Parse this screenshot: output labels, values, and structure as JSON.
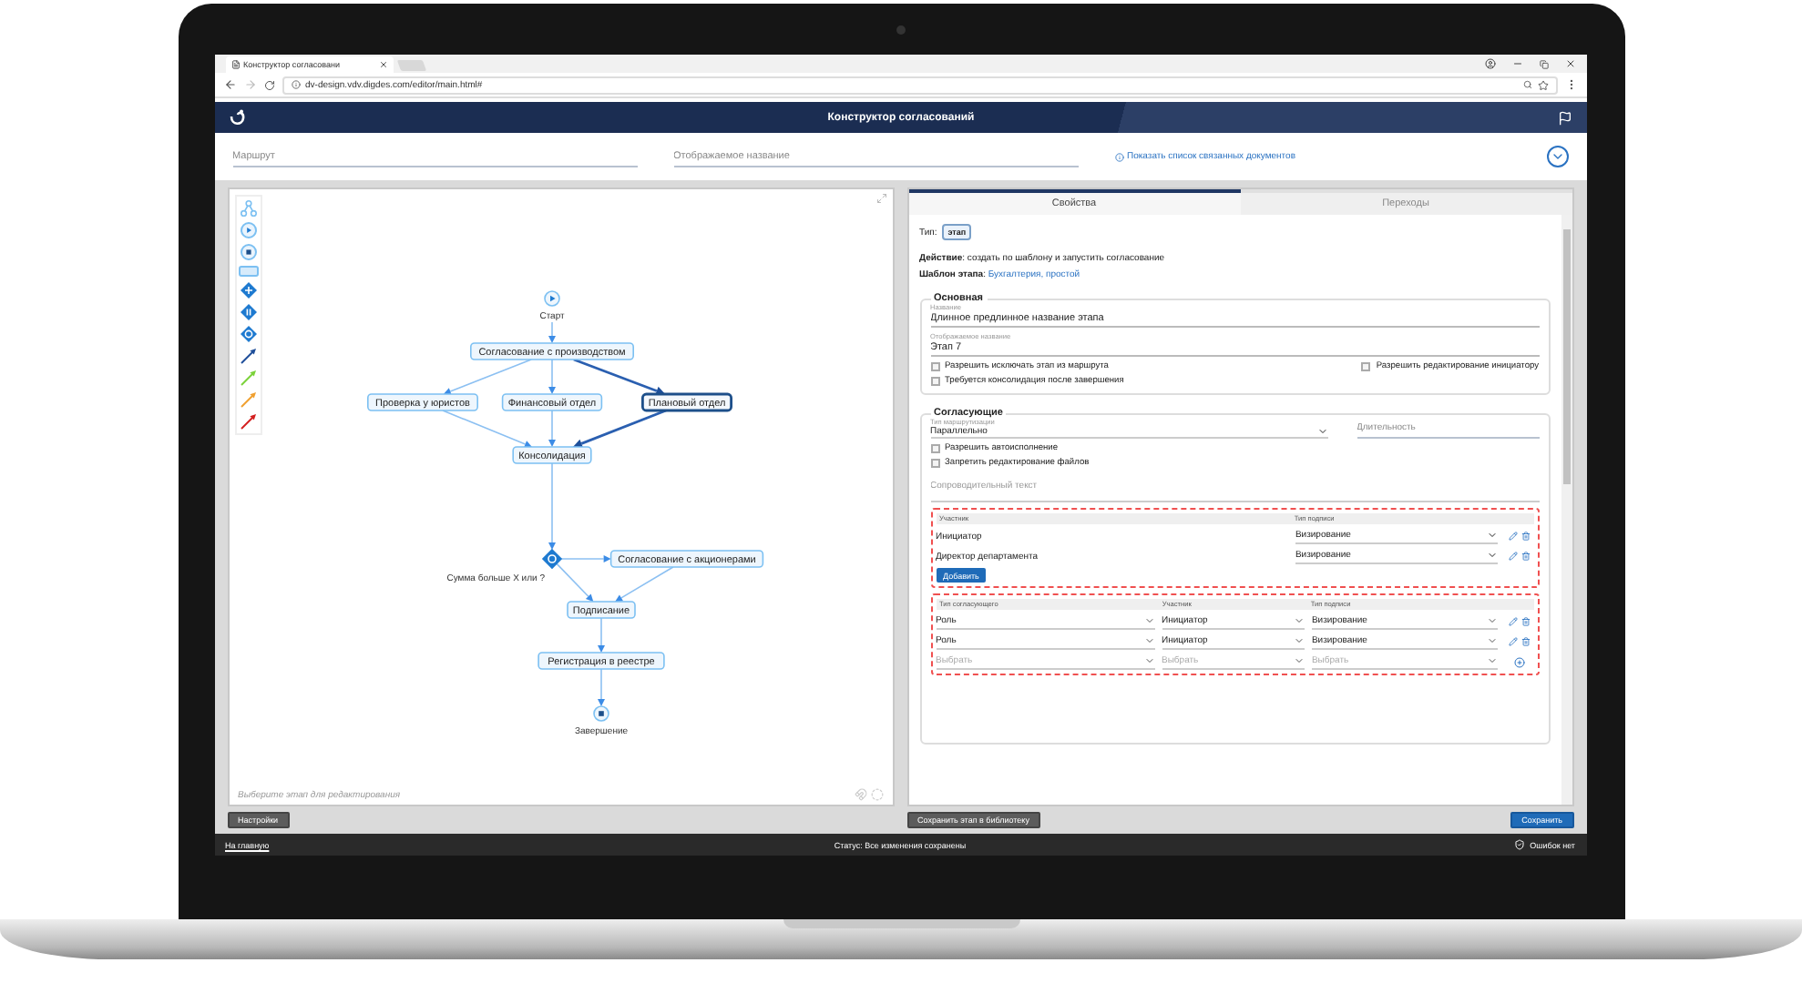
{
  "browser": {
    "tab_title": "Конструктор согласовани",
    "url": "dv-design.vdv.digdes.com/editor/main.html#"
  },
  "header": {
    "title": "Конструктор согласований"
  },
  "route_fields": [
    {
      "placeholder": "Маршрут"
    },
    {
      "placeholder": "Отображаемое название"
    }
  ],
  "related_link": "Показать список связанных документов",
  "diagram": {
    "nodes": [
      {
        "kind": "start",
        "label": "Старт",
        "selected": false
      },
      {
        "kind": "task",
        "label": "Согласование с производством",
        "selected": false
      },
      {
        "kind": "task",
        "label": "Проверка у юристов",
        "selected": false
      },
      {
        "kind": "task",
        "label": "Финансовый отдел",
        "selected": false
      },
      {
        "kind": "task",
        "label": "Плановый отдел",
        "selected": true
      },
      {
        "kind": "task",
        "label": "Консолидация",
        "selected": false
      },
      {
        "kind": "gateway",
        "label": "Сумма больше Х или ?",
        "selected": false
      },
      {
        "kind": "task",
        "label": "Согласование с акционерами",
        "selected": false
      },
      {
        "kind": "task",
        "label": "Подписание",
        "selected": false
      },
      {
        "kind": "task",
        "label": "Регистрация в реестре",
        "selected": false
      },
      {
        "kind": "end",
        "label": "Завершение",
        "selected": false
      }
    ],
    "edges": [
      {
        "selected": false
      },
      {
        "selected": false
      },
      {
        "selected": false
      },
      {
        "selected": true
      },
      {
        "selected": false
      },
      {
        "selected": false
      },
      {
        "selected": true
      },
      {
        "selected": false
      },
      {
        "selected": false
      },
      {
        "selected": false
      },
      {
        "selected": false
      },
      {
        "selected": false
      },
      {
        "selected": false
      }
    ],
    "hint": "Выберите этап для редактирования"
  },
  "settings_button": "Настройки",
  "tabs": [
    {
      "label": "Свойства",
      "selected": true
    },
    {
      "label": "Переходы",
      "selected": false
    }
  ],
  "properties": {
    "type_label": "Тип:",
    "type_badge": "этап",
    "action": "**Действие**: создать по шаблону и запустить согласование",
    "template_label": "**Шаблон этапа**:",
    "template_link": "Бухгалтерия, простой"
  },
  "main_section": {
    "legend": "Основная",
    "fields": [
      {
        "label": "Название",
        "value": "Длинное предлинное название этапа"
      },
      {
        "label": "Отображаемое название",
        "value": "Этап 7"
      }
    ],
    "checkboxes": [
      {
        "label": "Разрешить исключать этап из маршрута",
        "checked": false
      },
      {
        "label": "Разрешить редактирование инициатору",
        "checked": false
      },
      {
        "label": "Требуется консолидация после завершения",
        "checked": false
      }
    ]
  },
  "approvers_section": {
    "legend": "Согласующие",
    "routing": {
      "label": "Тип маршрутизации",
      "value": "Параллельно"
    },
    "duration": {
      "placeholder": "Длительность"
    },
    "checkboxes": [
      {
        "label": "Разрешить автоисполнение",
        "checked": false
      },
      {
        "label": "Запретить редактирование файлов",
        "checked": false
      }
    ],
    "comment": {
      "placeholder": "Сопроводительный текст"
    },
    "participants": {
      "columns": [
        "Участник",
        "Тип подписи"
      ],
      "rows": [
        {
          "participant": "Инициатор",
          "signature": "Визирование"
        },
        {
          "participant": "Директор департамента",
          "signature": "Визирование"
        }
      ],
      "add_button": "Добавить"
    },
    "approver_types": {
      "columns": [
        "Тип согласующего",
        "Участник",
        "Тип подписи"
      ],
      "rows": [
        {
          "kind": "filled",
          "cells": [
            "Роль",
            "Инициатор",
            "Визирование"
          ]
        },
        {
          "kind": "filled",
          "cells": [
            "Роль",
            "Инициатор",
            "Визирование"
          ]
        },
        {
          "kind": "new",
          "cells": [
            "Выбрать",
            "Выбрать",
            "Выбрать"
          ]
        }
      ]
    }
  },
  "footer_buttons": {
    "save_to_library": "Сохранить этап в библиотеку",
    "save": "Сохранить"
  },
  "status_bar": {
    "home_link": "На главную",
    "status": "Статус: Все изменения сохранены",
    "errors": "Ошибок нет"
  }
}
